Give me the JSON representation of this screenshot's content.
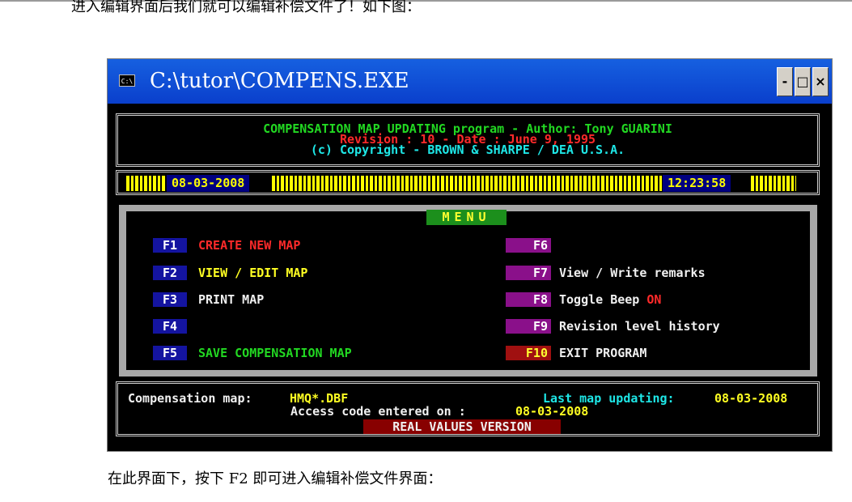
{
  "doc": {
    "intro_text": "进入编辑界面后我们就可以编辑补偿文件了！如下图：",
    "bottom_text": "在此界面下，按下 F2 即可进入编辑补偿文件界面："
  },
  "window": {
    "title": "C:\\tutor\\COMPENS.EXE",
    "icon_text": "C:\\",
    "buttons": {
      "minimize": "-",
      "maximize": "□",
      "close": "×"
    }
  },
  "header": {
    "line1": "COMPENSATION MAP UPDATING program - Author: Tony GUARINI",
    "line2": "Revision : 10 - Date : June 9, 1995",
    "line3": "(c) Copyright - BROWN & SHARPE / DEA U.S.A."
  },
  "status_bar": {
    "date": "08-03-2008",
    "time": "12:23:58"
  },
  "menu": {
    "title": "MENU",
    "left": [
      {
        "key": "F1",
        "label": "CREATE NEW MAP"
      },
      {
        "key": "F2",
        "label": "VIEW / EDIT MAP"
      },
      {
        "key": "F3",
        "label": "PRINT MAP"
      },
      {
        "key": "F4",
        "label": ""
      },
      {
        "key": "F5",
        "label": "SAVE COMPENSATION MAP"
      }
    ],
    "right": [
      {
        "key": "F6",
        "label": ""
      },
      {
        "key": "F7",
        "label": "View / Write remarks"
      },
      {
        "key": "F8",
        "label": "Toggle Beep",
        "state": "ON"
      },
      {
        "key": "F9",
        "label": "Revision level history"
      },
      {
        "key": "F10",
        "label": "EXIT PROGRAM"
      }
    ]
  },
  "footer": {
    "comp_map_label": "Compensation map:",
    "comp_map_value": "HMQ*.DBF",
    "last_update_label": "Last map updating:",
    "last_update_value": "08-03-2008",
    "access_label": "Access code entered on :",
    "access_value": "08-03-2008",
    "version": "REAL VALUES VERSION"
  },
  "colors": {
    "title_bar": "#0a3fcc",
    "green": "#22d822",
    "red": "#ff2a2a",
    "cyan": "#1ee6e6",
    "yellow": "#ffff22",
    "fkey_blue": "#1414a0",
    "fkey_purple": "#8a108a"
  }
}
